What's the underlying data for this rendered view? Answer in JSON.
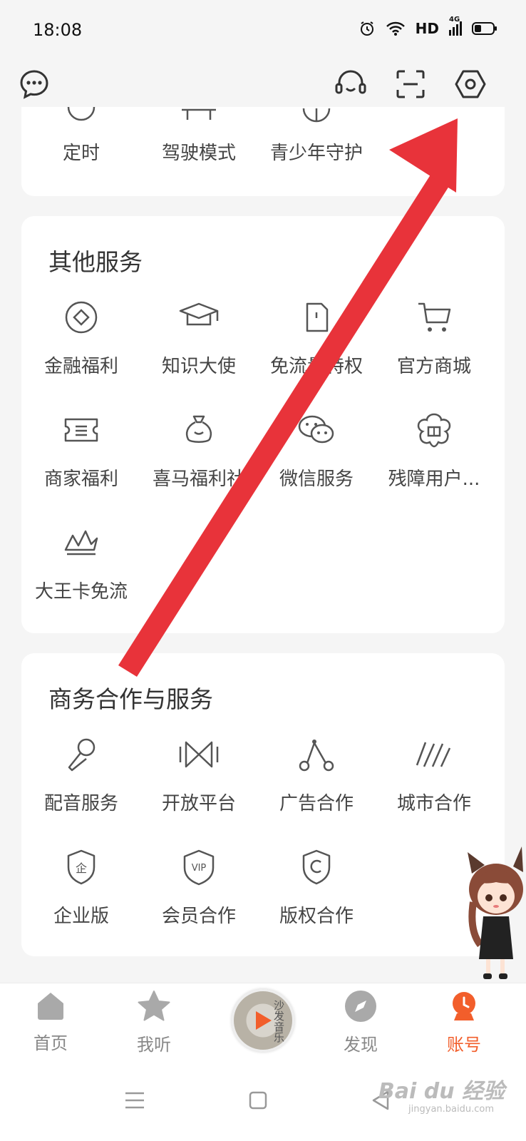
{
  "status": {
    "time": "18:08",
    "network": "HD",
    "cell": "4G"
  },
  "partial_card": {
    "items": [
      "定时",
      "驾驶模式",
      "青少年守护"
    ]
  },
  "other_services": {
    "title": "其他服务",
    "items": [
      {
        "label": "金融福利",
        "icon": "finance-icon"
      },
      {
        "label": "知识大使",
        "icon": "graduation-cap-icon"
      },
      {
        "label": "免流量特权",
        "icon": "sim-card-icon"
      },
      {
        "label": "官方商城",
        "icon": "cart-icon"
      },
      {
        "label": "商家福利",
        "icon": "ticket-icon"
      },
      {
        "label": "喜马福利社",
        "icon": "money-bag-icon"
      },
      {
        "label": "微信服务",
        "icon": "wechat-icon"
      },
      {
        "label": "残障用户...",
        "icon": "gift-flower-icon"
      },
      {
        "label": "大王卡免流",
        "icon": "crown-icon"
      }
    ]
  },
  "business": {
    "title": "商务合作与服务",
    "items": [
      {
        "label": "配音服务",
        "icon": "microphone-icon"
      },
      {
        "label": "开放平台",
        "icon": "open-platform-icon"
      },
      {
        "label": "广告合作",
        "icon": "ad-icon"
      },
      {
        "label": "城市合作",
        "icon": "city-icon"
      },
      {
        "label": "企业版",
        "icon": "enterprise-shield-icon"
      },
      {
        "label": "会员合作",
        "icon": "vip-icon"
      },
      {
        "label": "版权合作",
        "icon": "copyright-icon"
      }
    ]
  },
  "tabs": [
    {
      "label": "首页",
      "icon": "home-icon"
    },
    {
      "label": "我听",
      "icon": "star-icon"
    },
    {
      "label": "",
      "icon": "player-disc-icon",
      "disc_text": "沙发音乐"
    },
    {
      "label": "发现",
      "icon": "compass-icon"
    },
    {
      "label": "账号",
      "icon": "account-icon"
    }
  ],
  "watermark": {
    "text": "Bai du 经验",
    "sub": "jingyan.baidu.com"
  },
  "colors": {
    "accent": "#f25e2b",
    "arrow": "#e8333a",
    "card_bg": "#ffffff",
    "page_bg": "#f5f5f5"
  }
}
